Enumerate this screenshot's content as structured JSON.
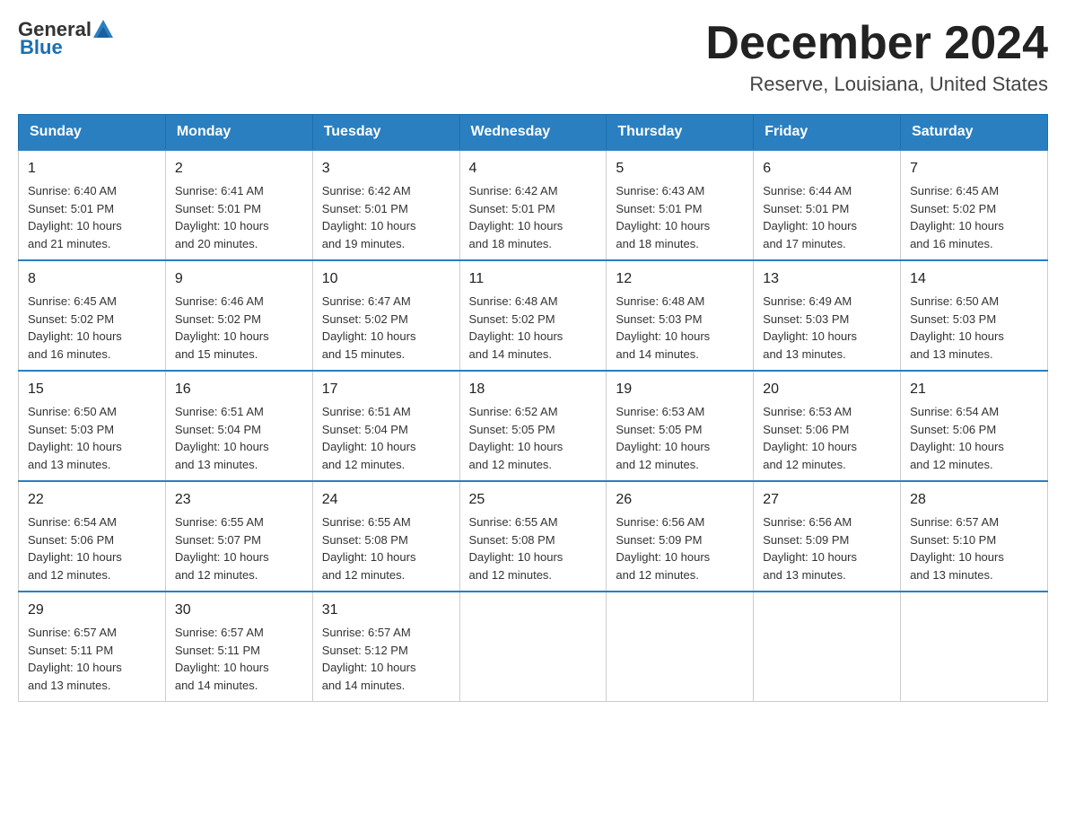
{
  "header": {
    "logo": {
      "text_general": "General",
      "text_blue": "Blue"
    },
    "title": "December 2024",
    "subtitle": "Reserve, Louisiana, United States"
  },
  "weekdays": [
    "Sunday",
    "Monday",
    "Tuesday",
    "Wednesday",
    "Thursday",
    "Friday",
    "Saturday"
  ],
  "weeks": [
    [
      {
        "day": "1",
        "sunrise": "6:40 AM",
        "sunset": "5:01 PM",
        "daylight": "10 hours and 21 minutes."
      },
      {
        "day": "2",
        "sunrise": "6:41 AM",
        "sunset": "5:01 PM",
        "daylight": "10 hours and 20 minutes."
      },
      {
        "day": "3",
        "sunrise": "6:42 AM",
        "sunset": "5:01 PM",
        "daylight": "10 hours and 19 minutes."
      },
      {
        "day": "4",
        "sunrise": "6:42 AM",
        "sunset": "5:01 PM",
        "daylight": "10 hours and 18 minutes."
      },
      {
        "day": "5",
        "sunrise": "6:43 AM",
        "sunset": "5:01 PM",
        "daylight": "10 hours and 18 minutes."
      },
      {
        "day": "6",
        "sunrise": "6:44 AM",
        "sunset": "5:01 PM",
        "daylight": "10 hours and 17 minutes."
      },
      {
        "day": "7",
        "sunrise": "6:45 AM",
        "sunset": "5:02 PM",
        "daylight": "10 hours and 16 minutes."
      }
    ],
    [
      {
        "day": "8",
        "sunrise": "6:45 AM",
        "sunset": "5:02 PM",
        "daylight": "10 hours and 16 minutes."
      },
      {
        "day": "9",
        "sunrise": "6:46 AM",
        "sunset": "5:02 PM",
        "daylight": "10 hours and 15 minutes."
      },
      {
        "day": "10",
        "sunrise": "6:47 AM",
        "sunset": "5:02 PM",
        "daylight": "10 hours and 15 minutes."
      },
      {
        "day": "11",
        "sunrise": "6:48 AM",
        "sunset": "5:02 PM",
        "daylight": "10 hours and 14 minutes."
      },
      {
        "day": "12",
        "sunrise": "6:48 AM",
        "sunset": "5:03 PM",
        "daylight": "10 hours and 14 minutes."
      },
      {
        "day": "13",
        "sunrise": "6:49 AM",
        "sunset": "5:03 PM",
        "daylight": "10 hours and 13 minutes."
      },
      {
        "day": "14",
        "sunrise": "6:50 AM",
        "sunset": "5:03 PM",
        "daylight": "10 hours and 13 minutes."
      }
    ],
    [
      {
        "day": "15",
        "sunrise": "6:50 AM",
        "sunset": "5:03 PM",
        "daylight": "10 hours and 13 minutes."
      },
      {
        "day": "16",
        "sunrise": "6:51 AM",
        "sunset": "5:04 PM",
        "daylight": "10 hours and 13 minutes."
      },
      {
        "day": "17",
        "sunrise": "6:51 AM",
        "sunset": "5:04 PM",
        "daylight": "10 hours and 12 minutes."
      },
      {
        "day": "18",
        "sunrise": "6:52 AM",
        "sunset": "5:05 PM",
        "daylight": "10 hours and 12 minutes."
      },
      {
        "day": "19",
        "sunrise": "6:53 AM",
        "sunset": "5:05 PM",
        "daylight": "10 hours and 12 minutes."
      },
      {
        "day": "20",
        "sunrise": "6:53 AM",
        "sunset": "5:06 PM",
        "daylight": "10 hours and 12 minutes."
      },
      {
        "day": "21",
        "sunrise": "6:54 AM",
        "sunset": "5:06 PM",
        "daylight": "10 hours and 12 minutes."
      }
    ],
    [
      {
        "day": "22",
        "sunrise": "6:54 AM",
        "sunset": "5:06 PM",
        "daylight": "10 hours and 12 minutes."
      },
      {
        "day": "23",
        "sunrise": "6:55 AM",
        "sunset": "5:07 PM",
        "daylight": "10 hours and 12 minutes."
      },
      {
        "day": "24",
        "sunrise": "6:55 AM",
        "sunset": "5:08 PM",
        "daylight": "10 hours and 12 minutes."
      },
      {
        "day": "25",
        "sunrise": "6:55 AM",
        "sunset": "5:08 PM",
        "daylight": "10 hours and 12 minutes."
      },
      {
        "day": "26",
        "sunrise": "6:56 AM",
        "sunset": "5:09 PM",
        "daylight": "10 hours and 12 minutes."
      },
      {
        "day": "27",
        "sunrise": "6:56 AM",
        "sunset": "5:09 PM",
        "daylight": "10 hours and 13 minutes."
      },
      {
        "day": "28",
        "sunrise": "6:57 AM",
        "sunset": "5:10 PM",
        "daylight": "10 hours and 13 minutes."
      }
    ],
    [
      {
        "day": "29",
        "sunrise": "6:57 AM",
        "sunset": "5:11 PM",
        "daylight": "10 hours and 13 minutes."
      },
      {
        "day": "30",
        "sunrise": "6:57 AM",
        "sunset": "5:11 PM",
        "daylight": "10 hours and 14 minutes."
      },
      {
        "day": "31",
        "sunrise": "6:57 AM",
        "sunset": "5:12 PM",
        "daylight": "10 hours and 14 minutes."
      },
      null,
      null,
      null,
      null
    ]
  ]
}
